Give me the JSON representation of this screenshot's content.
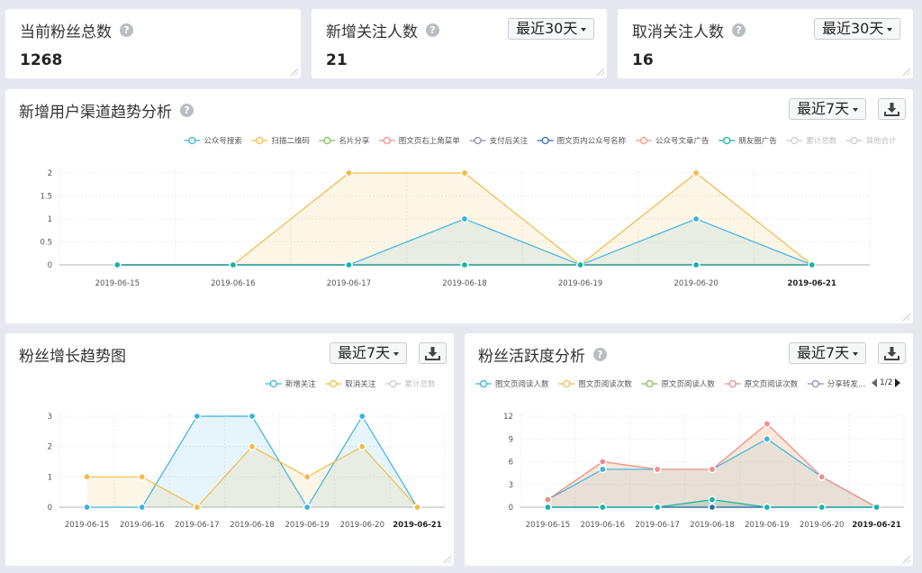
{
  "stats": [
    {
      "title": "当前粉丝总数",
      "value": "1268"
    },
    {
      "title": "新增关注人数",
      "value": "21",
      "range": "最近30天"
    },
    {
      "title": "取消关注人数",
      "value": "16",
      "range": "最近30天"
    }
  ],
  "panels": {
    "channel": {
      "title": "新增用户渠道趋势分析",
      "range": "最近7天"
    },
    "growth": {
      "title": "粉丝增长趋势图",
      "range": "最近7天"
    },
    "activity": {
      "title": "粉丝活跃度分析",
      "range": "最近7天",
      "pager": "1/2"
    }
  },
  "chart_data": [
    {
      "type": "area",
      "title": "新增用户渠道趋势分析",
      "categories": [
        "2019-06-15",
        "2019-06-16",
        "2019-06-17",
        "2019-06-18",
        "2019-06-19",
        "2019-06-20",
        "2019-06-21"
      ],
      "yticks": [
        "0",
        "0.5",
        "1",
        "1.5",
        "2"
      ],
      "ylim": [
        0,
        2
      ],
      "legend_position": "top-right",
      "series": [
        {
          "name": "公众号搜索",
          "color": "#3bb2e0",
          "values": [
            0,
            0,
            0,
            1,
            0,
            1,
            0
          ]
        },
        {
          "name": "扫描二维码",
          "color": "#f1bb48",
          "values": [
            0,
            0,
            2,
            2,
            0,
            2,
            0
          ]
        },
        {
          "name": "名片分享",
          "color": "#7ac254",
          "values": [
            0,
            0,
            0,
            0,
            0,
            0,
            0
          ]
        },
        {
          "name": "图文页右上角菜单",
          "color": "#ef8d8d",
          "values": [
            0,
            0,
            0,
            0,
            0,
            0,
            0
          ]
        },
        {
          "name": "支付后关注",
          "color": "#8c89b8",
          "values": [
            0,
            0,
            0,
            0,
            0,
            0,
            0
          ]
        },
        {
          "name": "图文页内公众号名称",
          "color": "#2b6bb0",
          "values": [
            0,
            0,
            0,
            0,
            0,
            0,
            0
          ]
        },
        {
          "name": "公众号文章广告",
          "color": "#ef9b7c",
          "values": [
            0,
            0,
            0,
            0,
            0,
            0,
            0
          ]
        },
        {
          "name": "朋友圈广告",
          "color": "#17b3a8",
          "values": [
            0,
            0,
            0,
            0,
            0,
            0,
            0
          ]
        },
        {
          "name": "累计总数",
          "color": "#cccccc",
          "hidden": true
        },
        {
          "name": "其他合计",
          "color": "#cccccc",
          "hidden": true
        }
      ]
    },
    {
      "type": "area",
      "title": "粉丝增长趋势图",
      "categories": [
        "2019-06-15",
        "2019-06-16",
        "2019-06-17",
        "2019-06-18",
        "2019-06-19",
        "2019-06-20",
        "2019-06-21"
      ],
      "yticks": [
        "0",
        "1",
        "2",
        "3"
      ],
      "ylim": [
        0,
        3
      ],
      "legend_position": "top-right",
      "series": [
        {
          "name": "新增关注",
          "color": "#3bb2e0",
          "values": [
            0,
            0,
            3,
            3,
            0,
            3,
            0
          ]
        },
        {
          "name": "取消关注",
          "color": "#f1bb48",
          "values": [
            1,
            1,
            0,
            2,
            1,
            2,
            0
          ]
        },
        {
          "name": "累计总数",
          "color": "#cccccc",
          "hidden": true
        }
      ]
    },
    {
      "type": "area",
      "title": "粉丝活跃度分析",
      "categories": [
        "2019-06-15",
        "2019-06-16",
        "2019-06-17",
        "2019-06-18",
        "2019-06-19",
        "2019-06-20",
        "2019-06-21"
      ],
      "yticks": [
        "0",
        "3",
        "6",
        "9",
        "12"
      ],
      "ylim": [
        0,
        12
      ],
      "legend_position": "top",
      "series": [
        {
          "name": "图文页阅读人数",
          "color": "#3bb2e0",
          "values": [
            1,
            5,
            5,
            5,
            9,
            4,
            0
          ]
        },
        {
          "name": "图文页阅读次数",
          "color": "#f1bb48",
          "values": [
            1,
            6,
            5,
            5,
            11,
            4,
            0
          ]
        },
        {
          "name": "原文页阅读人数",
          "color": "#7ac254",
          "values": [
            0,
            0,
            0,
            1,
            0,
            0,
            0
          ]
        },
        {
          "name": "原文页阅读次数",
          "color": "#ef8d8d",
          "values": [
            1,
            6,
            5,
            5,
            11,
            4,
            0
          ]
        },
        {
          "name": "分享转发…",
          "color": "#8c89b8",
          "values": [
            0,
            0,
            0,
            0,
            0,
            0,
            0
          ]
        },
        {
          "name": "",
          "color": "#2b6bb0",
          "values": [
            0,
            0,
            0,
            0,
            0,
            0,
            0
          ]
        },
        {
          "name": "",
          "color": "#17b3a8",
          "values": [
            0,
            0,
            0,
            1,
            0,
            0,
            0
          ]
        }
      ]
    }
  ]
}
